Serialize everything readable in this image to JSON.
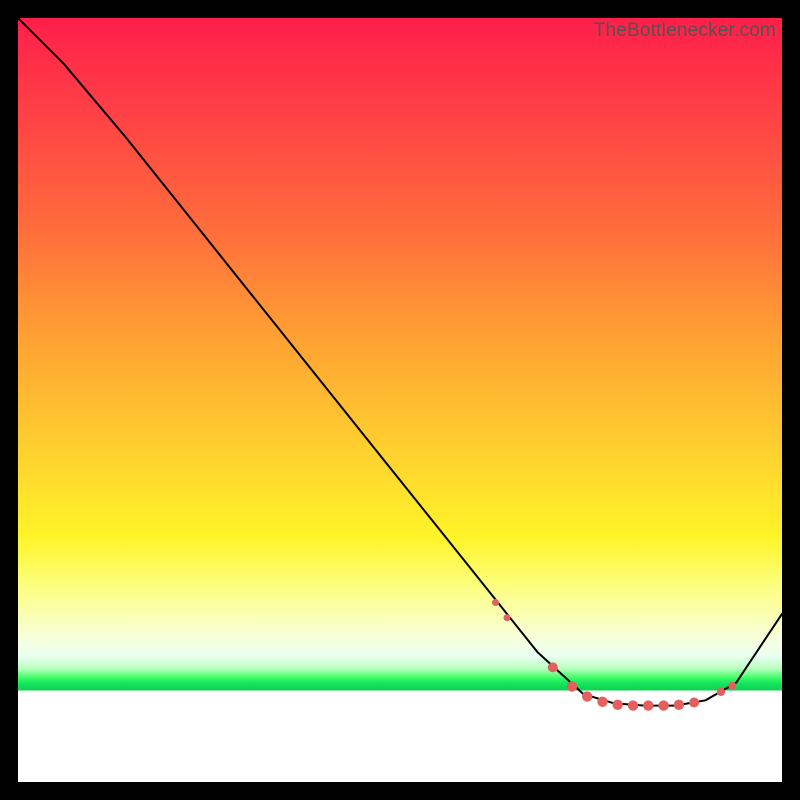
{
  "watermark": "TheBottlenecker.com",
  "chart_data": {
    "type": "line",
    "title": "",
    "xlabel": "",
    "ylabel": "",
    "xlim": [
      0,
      100
    ],
    "ylim": [
      0,
      100
    ],
    "axes_visible": false,
    "grid": false,
    "background_gradient": {
      "direction": "vertical",
      "stops": [
        {
          "pos": 0.0,
          "color": "#ff1f4a"
        },
        {
          "pos": 0.28,
          "color": "#ff6e3b"
        },
        {
          "pos": 0.58,
          "color": "#ffd52e"
        },
        {
          "pos": 0.8,
          "color": "#f8ffd0"
        },
        {
          "pos": 0.87,
          "color": "#16e85c"
        },
        {
          "pos": 0.88,
          "color": "#ffffff"
        }
      ]
    },
    "series": [
      {
        "name": "bottleneck-curve",
        "color": "#000000",
        "x": [
          0,
          6,
          14,
          22,
          30,
          38,
          46,
          54,
          62,
          68,
          74,
          78,
          82,
          86,
          90,
          94,
          100
        ],
        "y": [
          100,
          94,
          84.5,
          74.5,
          64.5,
          54.5,
          44.5,
          34.5,
          24.5,
          17,
          11.5,
          10.3,
          10.0,
          10.0,
          10.7,
          13,
          22
        ]
      }
    ],
    "markers": {
      "name": "highlight-dots",
      "color": "#e4605e",
      "points": [
        {
          "x": 62.5,
          "y": 23.5,
          "r": 3.5
        },
        {
          "x": 64.0,
          "y": 21.5,
          "r": 3.5
        },
        {
          "x": 70.0,
          "y": 15.0,
          "r": 5.0
        },
        {
          "x": 72.5,
          "y": 12.5,
          "r": 5.2
        },
        {
          "x": 74.5,
          "y": 11.2,
          "r": 5.2
        },
        {
          "x": 76.5,
          "y": 10.5,
          "r": 5.2
        },
        {
          "x": 78.5,
          "y": 10.1,
          "r": 5.2
        },
        {
          "x": 80.5,
          "y": 10.0,
          "r": 5.2
        },
        {
          "x": 82.5,
          "y": 10.0,
          "r": 5.2
        },
        {
          "x": 84.5,
          "y": 10.0,
          "r": 5.2
        },
        {
          "x": 86.5,
          "y": 10.1,
          "r": 5.2
        },
        {
          "x": 88.5,
          "y": 10.4,
          "r": 5.0
        },
        {
          "x": 92.0,
          "y": 11.8,
          "r": 4.2
        },
        {
          "x": 93.5,
          "y": 12.6,
          "r": 4.0
        }
      ]
    }
  }
}
